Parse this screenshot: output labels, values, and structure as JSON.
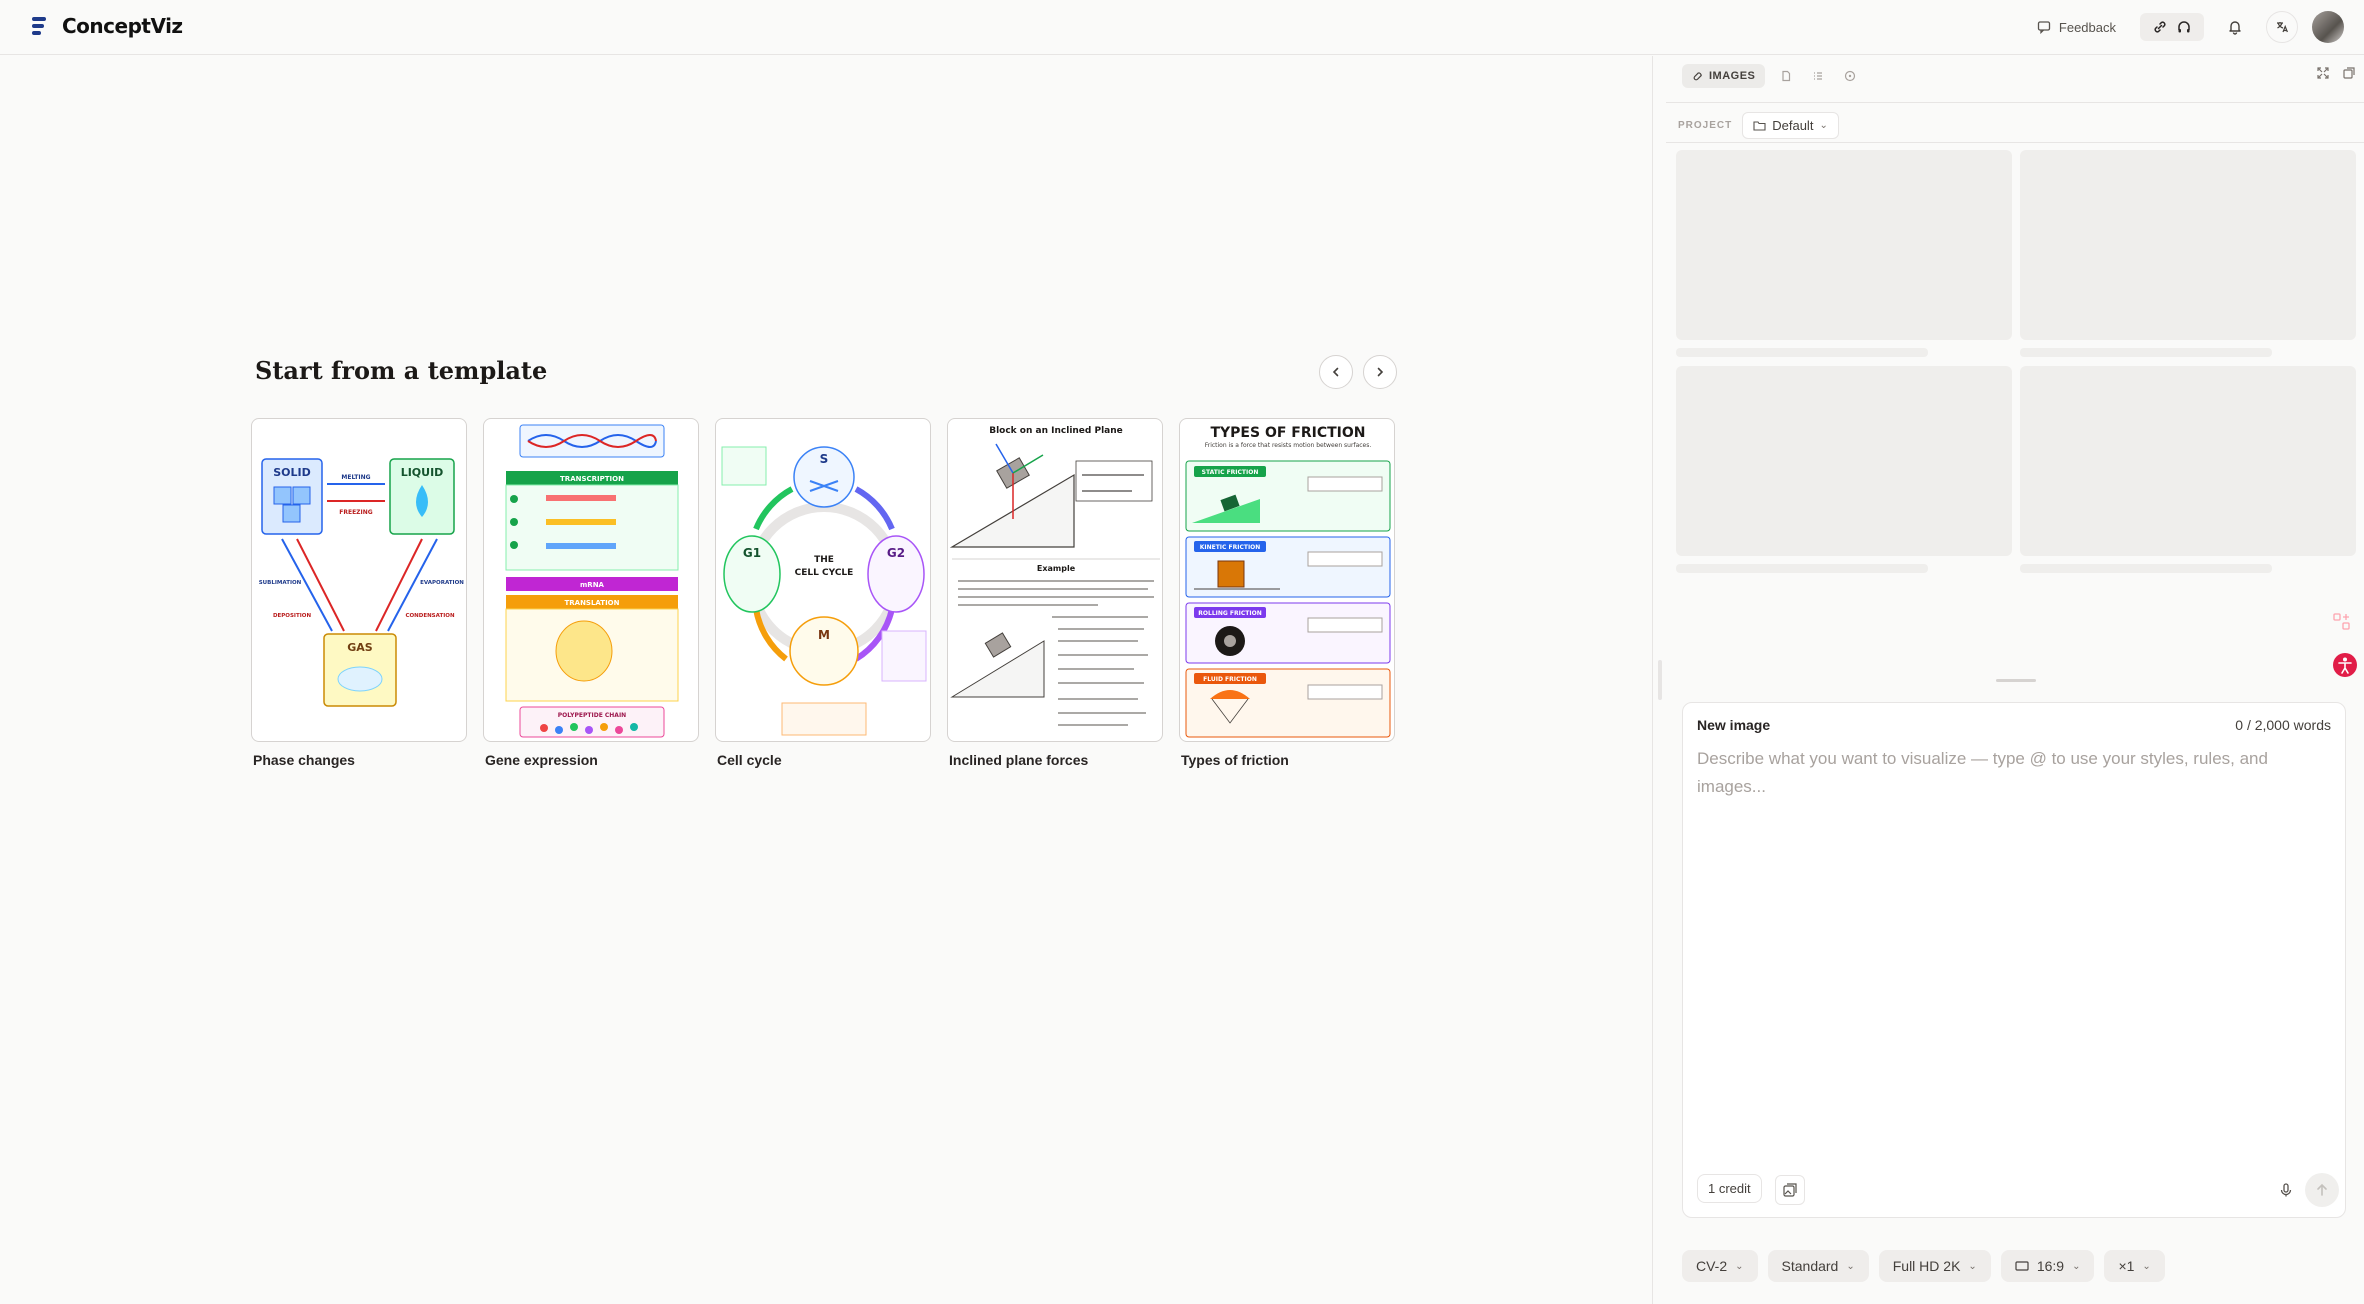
{
  "app": {
    "name": "ConceptViz"
  },
  "topbar": {
    "feedback_label": "Feedback"
  },
  "templates": {
    "title": "Start from a template",
    "items": [
      {
        "label": "Phase changes"
      },
      {
        "label": "Gene expression"
      },
      {
        "label": "Cell cycle"
      },
      {
        "label": "Inclined plane forces"
      },
      {
        "label": "Types of friction"
      }
    ],
    "thumbs": {
      "phase": {
        "solid": "SOLID",
        "liquid": "LIQUID",
        "gas": "GAS",
        "melting": "MELTING",
        "freezing": "FREEZING",
        "sublimation": "SUBLIMATION",
        "evaporation": "EVAPORATION",
        "deposition": "DEPOSITION",
        "condensation": "CONDENSATION"
      },
      "gene": {
        "transcription": "TRANSCRIPTION",
        "translation": "TRANSLATION",
        "mrna": "mRNA",
        "chain": "POLYPEPTIDE CHAIN"
      },
      "cycle": {
        "title_1": "THE",
        "title_2": "CELL CYCLE",
        "s": "S",
        "g1": "G1",
        "g2": "G2",
        "m": "M"
      },
      "incline": {
        "title": "Block on an Inclined Plane",
        "example": "Example"
      },
      "friction": {
        "title": "TYPES OF FRICTION",
        "subtitle": "Friction is a force that resists motion between surfaces.",
        "static": "STATIC FRICTION",
        "kinetic": "KINETIC FRICTION",
        "rolling": "ROLLING FRICTION",
        "fluid": "FLUID FRICTION"
      }
    }
  },
  "panel": {
    "tab_active": "IMAGES",
    "project_label": "PROJECT",
    "project_value": "Default"
  },
  "composer": {
    "title": "New image",
    "word_count": "0 / 2,000 words",
    "placeholder": "Describe what you want to visualize — type @ to use your styles, rules, and images...",
    "credit": "1 credit"
  },
  "options": {
    "model": "CV-2",
    "quality": "Standard",
    "resolution": "Full HD 2K",
    "aspect": "16:9",
    "count": "×1"
  },
  "colors": {
    "accent": "#1e3a8a",
    "brand_pink": "#e11d48"
  }
}
